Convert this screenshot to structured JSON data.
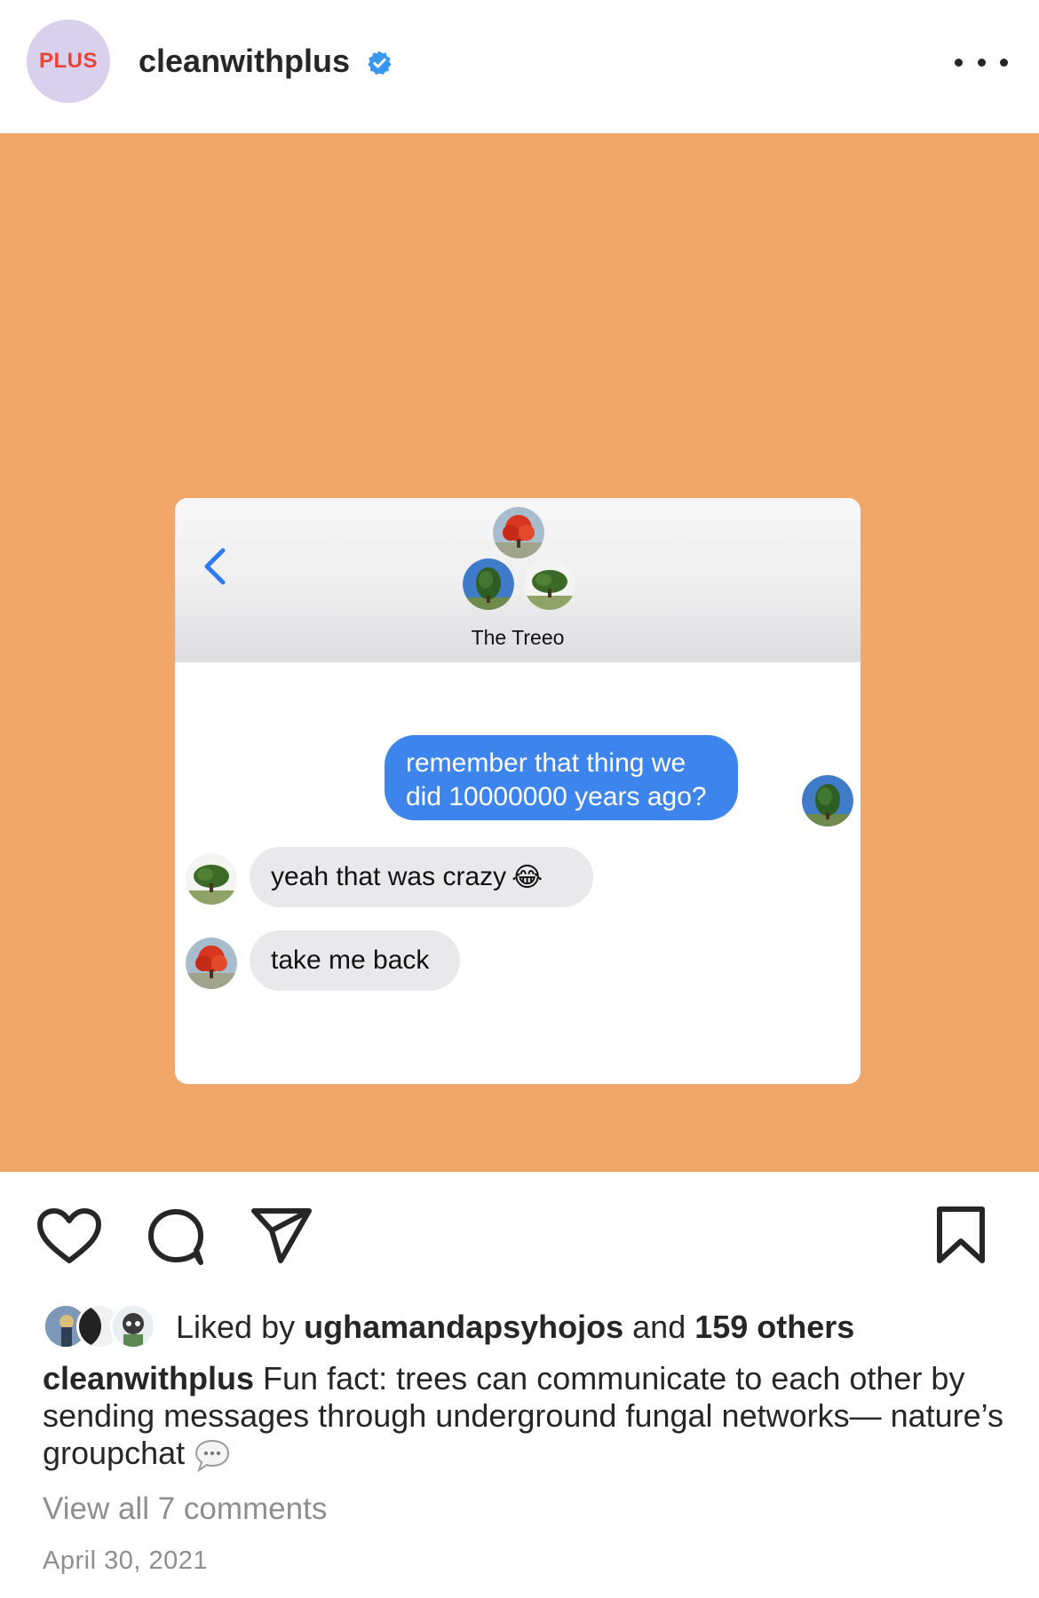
{
  "header": {
    "avatar_text": "PLUS",
    "username": "cleanwithplus",
    "verified_icon": "verified-badge-icon",
    "more_icon": "more-options-icon"
  },
  "post_image": {
    "background_color": "#f1a769",
    "chat": {
      "group_name": "The Treeo",
      "messages": [
        {
          "direction": "out",
          "text": "remember that thing we did 10000000 years ago?"
        },
        {
          "direction": "in",
          "text": "yeah that was crazy"
        },
        {
          "direction": "in",
          "text": "take me back"
        }
      ],
      "emoji": "😂"
    }
  },
  "actions": {
    "like_icon": "heart-icon",
    "comment_icon": "comment-icon",
    "share_icon": "paper-plane-icon",
    "save_icon": "bookmark-icon"
  },
  "likes": {
    "prefix": "Liked by ",
    "user": "ughamandapsyhojos",
    "middle": " and ",
    "others": "159 others"
  },
  "caption": {
    "username": "cleanwithplus",
    "text": " Fun fact: trees can communicate to each other by sending messages through underground fungal networks— nature’s groupchat "
  },
  "comments_link": "View all 7 comments",
  "date": "April 30, 2021"
}
